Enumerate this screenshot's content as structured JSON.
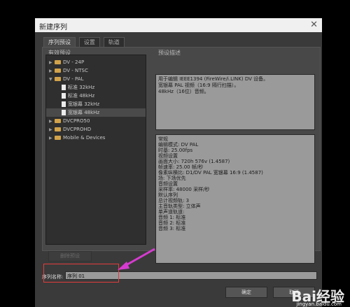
{
  "window": {
    "title": "新建序列",
    "close_icon": "close-icon"
  },
  "tabs": [
    {
      "label": "序列预设",
      "active": true
    },
    {
      "label": "设置",
      "active": false
    },
    {
      "label": "轨道",
      "active": false
    }
  ],
  "presets": {
    "group_label": "有效预设",
    "items": [
      {
        "label": "DV - 24P",
        "type": "folder",
        "expanded": false
      },
      {
        "label": "DV - NTSC",
        "type": "folder",
        "expanded": false
      },
      {
        "label": "DV - PAL",
        "type": "folder",
        "expanded": true
      },
      {
        "label": "标准 32kHz",
        "type": "file"
      },
      {
        "label": "标准 48kHz",
        "type": "file"
      },
      {
        "label": "宽银幕 32kHz",
        "type": "file"
      },
      {
        "label": "宽银幕 48kHz",
        "type": "file",
        "selected": true
      },
      {
        "label": "DVCPRO50",
        "type": "folder",
        "expanded": false
      },
      {
        "label": "DVCPROHD",
        "type": "folder",
        "expanded": false
      },
      {
        "label": "Mobile & Devices",
        "type": "folder",
        "expanded": false
      }
    ],
    "delete_button": "删除预设"
  },
  "description": {
    "group_label": "预设描述",
    "lines": [
      "用于编辑 IEEE1394 (FireWire/i.LINK) DV 设备。",
      "宽银幕 PAL 视频（16:9 隔行扫描）。",
      "48kHz（16位）音频。"
    ]
  },
  "info": {
    "lines": [
      "常规",
      "编辑模式: DV PAL",
      "时基: 25.00fps",
      "",
      "视频设置",
      "画面大小: 720h 576v (1.4587)",
      "帧速率: 25.00 帧/秒",
      "像素纵横比: D1/DV PAL 宽银幕 16:9 (1.4587)",
      "场: 下场优先",
      "",
      "音频设置",
      "采样率: 48000 采样/秒",
      "",
      "默认序列",
      "总计视频轨: 3",
      "主音轨类型: 立体声",
      "单声道轨道:",
      "音频 1: 标准",
      "音频 2: 标准",
      "音频 3: 标准"
    ]
  },
  "sequence_name": {
    "label": "序列名称:",
    "value": "序列 01"
  },
  "buttons": {
    "ok": "确定",
    "cancel": "取消"
  },
  "watermark": {
    "brand": "Bai经验",
    "sub": "jingyan.baidu.com"
  },
  "colors": {
    "highlight": "#e53c3c",
    "pointer": "#d63bd0",
    "folder": "#d2a34a"
  }
}
